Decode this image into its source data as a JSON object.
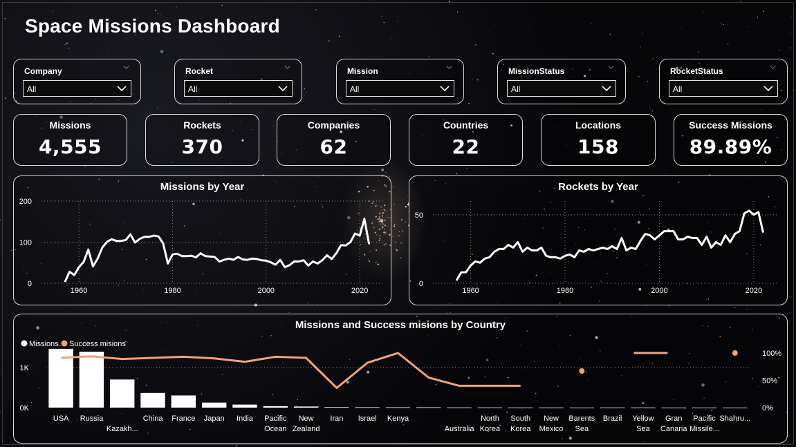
{
  "page_title": "Space Missions Dashboard",
  "filters": [
    {
      "label": "Company",
      "value": "All"
    },
    {
      "label": "Rocket",
      "value": "All"
    },
    {
      "label": "Mission",
      "value": "All"
    },
    {
      "label": "MissionStatus",
      "value": "All"
    },
    {
      "label": "RocketStatus",
      "value": "All"
    }
  ],
  "kpis": [
    {
      "label": "Missions",
      "value": "4,555"
    },
    {
      "label": "Rockets",
      "value": "370"
    },
    {
      "label": "Companies",
      "value": "62"
    },
    {
      "label": "Countries",
      "value": "22"
    },
    {
      "label": "Locations",
      "value": "158"
    },
    {
      "label": "Success Missions",
      "value": "89.89%"
    }
  ],
  "colors": {
    "missions": "#ffffff",
    "success": "#f0a27c",
    "border": "#d8d8d8",
    "background": "#050507"
  },
  "chart_data": [
    {
      "type": "line",
      "title": "Missions by Year",
      "x_ticks": [
        "1960",
        "1980",
        "2000",
        "2020"
      ],
      "y_ticks": [
        "0",
        "100",
        "200"
      ],
      "xlim": [
        1952,
        2025
      ],
      "ylim": [
        0,
        200
      ],
      "grid": true,
      "series": [
        {
          "x": [
            1957,
            1958,
            1959,
            1960,
            1961,
            1962,
            1963,
            1964,
            1965,
            1966,
            1967,
            1968,
            1969,
            1970,
            1971,
            1972,
            1973,
            1974,
            1975,
            1976,
            1977,
            1978,
            1979,
            1980,
            1981,
            1982,
            1983,
            1984,
            1985,
            1986,
            1987,
            1988,
            1989,
            1990,
            1991,
            1992,
            1993,
            1994,
            1995,
            1996,
            1997,
            1998,
            1999,
            2000,
            2001,
            2002,
            2003,
            2004,
            2005,
            2006,
            2007,
            2008,
            2009,
            2010,
            2011,
            2012,
            2013,
            2014,
            2015,
            2016,
            2017,
            2018,
            2019,
            2020,
            2021,
            2022
          ],
          "y": [
            3,
            28,
            20,
            39,
            52,
            82,
            41,
            60,
            87,
            101,
            107,
            103,
            103,
            105,
            119,
            99,
            108,
            113,
            113,
            116,
            114,
            97,
            48,
            70,
            72,
            66,
            66,
            67,
            63,
            73,
            66,
            65,
            64,
            53,
            57,
            60,
            57,
            64,
            58,
            57,
            60,
            59,
            56,
            55,
            51,
            45,
            57,
            39,
            44,
            53,
            53,
            56,
            43,
            53,
            48,
            56,
            68,
            59,
            73,
            93,
            92,
            100,
            121,
            116,
            157,
            95
          ]
        }
      ]
    },
    {
      "type": "line",
      "title": "Rockets by Year",
      "x_ticks": [
        "1960",
        "1980",
        "2000",
        "2020"
      ],
      "y_ticks": [
        "0",
        "50"
      ],
      "xlim": [
        1952,
        2025
      ],
      "ylim": [
        0,
        60
      ],
      "grid": true,
      "series": [
        {
          "x": [
            1957,
            1958,
            1959,
            1960,
            1961,
            1962,
            1963,
            1964,
            1965,
            1966,
            1967,
            1968,
            1969,
            1970,
            1971,
            1972,
            1973,
            1974,
            1975,
            1976,
            1977,
            1978,
            1979,
            1980,
            1981,
            1982,
            1983,
            1984,
            1985,
            1986,
            1987,
            1988,
            1989,
            1990,
            1991,
            1992,
            1993,
            1994,
            1995,
            1996,
            1997,
            1998,
            1999,
            2000,
            2001,
            2002,
            2003,
            2004,
            2005,
            2006,
            2007,
            2008,
            2009,
            2010,
            2011,
            2012,
            2013,
            2014,
            2015,
            2016,
            2017,
            2018,
            2019,
            2020,
            2021,
            2022
          ],
          "y": [
            2,
            8,
            8,
            13,
            16,
            15,
            18,
            19,
            23,
            25,
            25,
            28,
            26,
            30,
            23,
            26,
            24,
            24,
            26,
            20,
            19,
            19,
            18,
            20,
            21,
            19,
            24,
            23,
            25,
            24,
            25,
            26,
            25,
            27,
            25,
            33,
            24,
            26,
            25,
            31,
            36,
            35,
            32,
            35,
            38,
            38,
            38,
            32,
            32,
            34,
            33,
            33,
            28,
            34,
            26,
            30,
            28,
            35,
            30,
            36,
            38,
            51,
            53,
            50,
            52,
            37
          ]
        }
      ]
    },
    {
      "type": "bar",
      "title": "Missions and Success misions by Country",
      "legend": [
        "Missions",
        "Success misions"
      ],
      "legend_position": "top-left",
      "categories": [
        "USA",
        "Russia",
        "Kazakh...",
        "China",
        "France",
        "Japan",
        "India",
        "Pacific Ocean",
        "New Zealand",
        "Iran",
        "Israel",
        "Kenya",
        "",
        "Australia",
        "North Korea",
        "South Korea",
        "New Mexico",
        "Barents Sea",
        "Brazil",
        "Yellow Sea",
        "Gran Canaria",
        "Pacific Missile...",
        "Shahru..."
      ],
      "category_lines": [
        [
          "USA"
        ],
        [
          "Russia"
        ],
        [
          "Kazakh..."
        ],
        [
          "China"
        ],
        [
          "France"
        ],
        [
          "Japan"
        ],
        [
          "India"
        ],
        [
          "Pacific",
          "Ocean"
        ],
        [
          "New",
          "Zealand"
        ],
        [
          "Iran"
        ],
        [
          "Israel"
        ],
        [
          "Kenya"
        ],
        [
          ""
        ],
        [
          "Australia"
        ],
        [
          "North",
          "Korea"
        ],
        [
          "South",
          "Korea"
        ],
        [
          "New",
          "Mexico"
        ],
        [
          "Barents",
          "Sea"
        ],
        [
          "Brazil"
        ],
        [
          "Yellow",
          "Sea"
        ],
        [
          "Gran",
          "Canaria"
        ],
        [
          "Pacific",
          "Missile..."
        ],
        [
          "Shahru..."
        ]
      ],
      "y_ticks_left": [
        "0K",
        "1K"
      ],
      "y_ticks_right": [
        "0%",
        "50%",
        "100%"
      ],
      "ylim_left": [
        0,
        1500
      ],
      "ylim_right": [
        0,
        1.1
      ],
      "series": [
        {
          "name": "Missions",
          "kind": "bar",
          "values": [
            1467,
            1395,
            701,
            366,
            303,
            126,
            76,
            36,
            28,
            14,
            11,
            9,
            8,
            6,
            5,
            3,
            4,
            2,
            3,
            3,
            2,
            1,
            2
          ]
        },
        {
          "name": "Success misions",
          "kind": "line",
          "values": [
            0.91,
            0.94,
            0.89,
            0.91,
            0.93,
            0.9,
            0.84,
            0.93,
            0.91,
            0.36,
            0.82,
            1.0,
            0.55,
            0.4,
            0.4,
            0.4,
            null,
            0.67,
            null,
            1.0,
            1.0,
            null,
            1.0
          ]
        }
      ]
    }
  ]
}
